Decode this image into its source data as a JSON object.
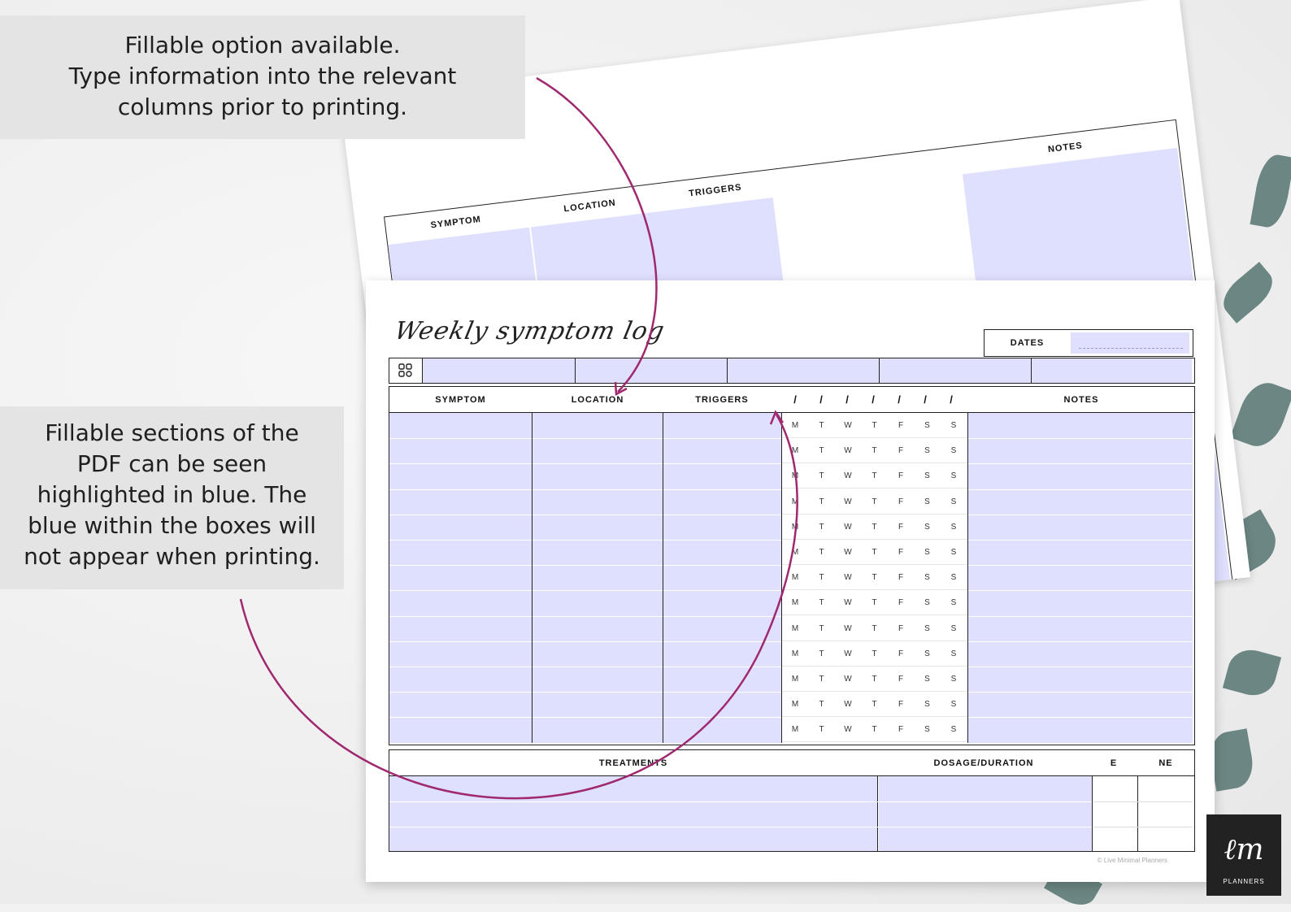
{
  "callouts": {
    "top": [
      "Fillable option available.",
      "Type information into the relevant",
      "columns prior to printing."
    ],
    "side": [
      "Fillable sections of the",
      "PDF can be seen",
      "highlighted in blue. The",
      "blue within the boxes will",
      "not appear when printing."
    ]
  },
  "sheet": {
    "title": "Weekly symptom log",
    "dates_label": "DATES",
    "headers": {
      "symptom": "SYMPTOM",
      "location": "LOCATION",
      "triggers": "TRIGGERS",
      "slashes": [
        "/",
        "/",
        "/",
        "/",
        "/",
        "/",
        "/"
      ],
      "notes": "NOTES"
    },
    "days": [
      "M",
      "T",
      "W",
      "T",
      "F",
      "S",
      "S"
    ],
    "row_count": 13,
    "bottom_headers": {
      "treatments": "TREATMENTS",
      "dosage": "DOSAGE/DURATION",
      "e": "E",
      "ne": "NE"
    },
    "copyright": "© Live Minimal Planners"
  },
  "back_sheet": {
    "symptom": "SYMPTOM",
    "location": "LOCATION",
    "triggers": "TRIGGERS",
    "notes": "NOTES"
  },
  "logo": {
    "text": "PLANNERS"
  },
  "colors": {
    "fill_blue": "#dfe0fe",
    "arrow": "#a0286e",
    "leaf": "#5f7d7a"
  }
}
